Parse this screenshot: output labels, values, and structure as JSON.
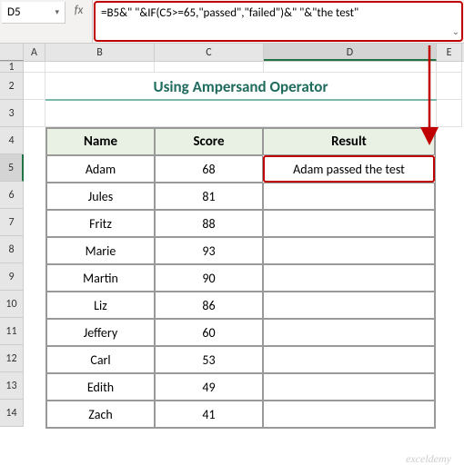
{
  "namebox": {
    "value": "D5",
    "dropdown_icon": "▾"
  },
  "fx_label": "fx",
  "formula": "=B5&\" \"&IF(C5>=65,\"passed\",\"failed\")&\" \"&\"the test\"",
  "columns": [
    "A",
    "B",
    "C",
    "D",
    "E"
  ],
  "rows": [
    "1",
    "2",
    "3",
    "4",
    "5",
    "6",
    "7",
    "8",
    "9",
    "10",
    "11",
    "12",
    "13",
    "14"
  ],
  "title": "Using Ampersand Operator",
  "headers": {
    "name": "Name",
    "score": "Score",
    "result": "Result"
  },
  "watermark": "exceldemy",
  "chart_data": {
    "type": "table",
    "title": "Using Ampersand Operator",
    "columns": [
      "Name",
      "Score",
      "Result"
    ],
    "rows": [
      {
        "name": "Adam",
        "score": 68,
        "result": "Adam passed the test"
      },
      {
        "name": "Jules",
        "score": 81,
        "result": ""
      },
      {
        "name": "Fritz",
        "score": 88,
        "result": ""
      },
      {
        "name": "Marie",
        "score": 93,
        "result": ""
      },
      {
        "name": "Martin",
        "score": 90,
        "result": ""
      },
      {
        "name": "Liz",
        "score": 86,
        "result": ""
      },
      {
        "name": "Jeffery",
        "score": 60,
        "result": ""
      },
      {
        "name": "Carl",
        "score": 53,
        "result": ""
      },
      {
        "name": "Edith",
        "score": 49,
        "result": ""
      },
      {
        "name": "Zach",
        "score": 41,
        "result": ""
      }
    ]
  }
}
